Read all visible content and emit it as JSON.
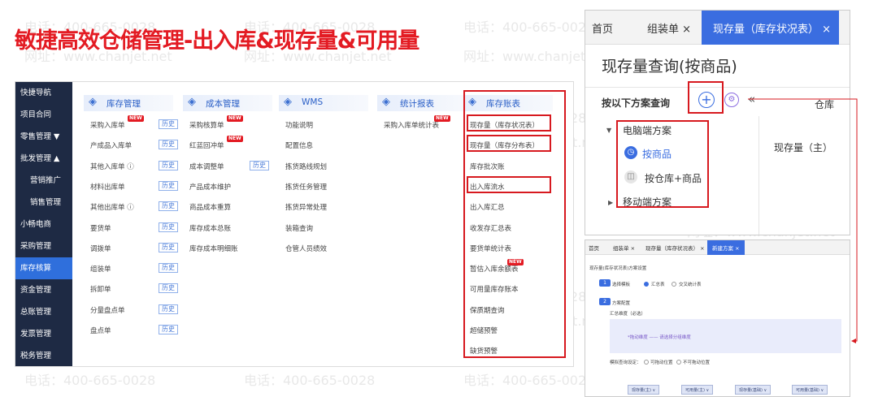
{
  "title": "敏捷高效仓储管理-出入库&现存量&可用量",
  "watermark": {
    "phone": "电话：400-665-0028",
    "site": "网址：www.chanjet.net"
  },
  "nav": {
    "items": [
      {
        "label": "快捷导航",
        "sub": false,
        "active": false
      },
      {
        "label": "项目合同",
        "sub": false,
        "active": false
      },
      {
        "label": "零售管理 ▼",
        "sub": false,
        "active": false
      },
      {
        "label": "批发管理 ▲",
        "sub": false,
        "active": false
      },
      {
        "label": "营销推广",
        "sub": true,
        "active": false
      },
      {
        "label": "销售管理",
        "sub": true,
        "active": false
      },
      {
        "label": "小畅电商",
        "sub": false,
        "active": false
      },
      {
        "label": "采购管理",
        "sub": false,
        "active": false
      },
      {
        "label": "库存核算",
        "sub": false,
        "active": true
      },
      {
        "label": "资金管理",
        "sub": false,
        "active": false
      },
      {
        "label": "总账管理",
        "sub": false,
        "active": false
      },
      {
        "label": "发票管理",
        "sub": false,
        "active": false
      },
      {
        "label": "税务管理",
        "sub": false,
        "active": false
      }
    ]
  },
  "history_label": "历史",
  "new_label": "NEW",
  "columns": [
    {
      "header": "库存管理",
      "items": [
        {
          "label": "采购入库单",
          "hist": true,
          "new": true
        },
        {
          "label": "产成品入库单",
          "hist": true,
          "new": false
        },
        {
          "label": "其他入库单 ⓘ",
          "hist": true,
          "new": false
        },
        {
          "label": "材料出库单",
          "hist": true,
          "new": false
        },
        {
          "label": "其他出库单 ⓘ",
          "hist": true,
          "new": false
        },
        {
          "label": "要货单",
          "hist": true,
          "new": false
        },
        {
          "label": "调拨单",
          "hist": true,
          "new": false
        },
        {
          "label": "组装单",
          "hist": true,
          "new": false
        },
        {
          "label": "拆卸单",
          "hist": true,
          "new": false
        },
        {
          "label": "分量盘点单",
          "hist": true,
          "new": false
        },
        {
          "label": "盘点单",
          "hist": true,
          "new": false
        }
      ]
    },
    {
      "header": "成本管理",
      "items": [
        {
          "label": "采购核算单",
          "hist": false,
          "new": true
        },
        {
          "label": "红蓝回冲单",
          "hist": false,
          "new": true
        },
        {
          "label": "成本调整单",
          "hist": true,
          "new": false
        },
        {
          "label": "产品成本维护",
          "hist": false,
          "new": false
        },
        {
          "label": "商品成本重算",
          "hist": false,
          "new": false
        },
        {
          "label": "库存成本总账",
          "hist": false,
          "new": false
        },
        {
          "label": "库存成本明细账",
          "hist": false,
          "new": false
        }
      ]
    },
    {
      "header": "WMS",
      "items": [
        {
          "label": "功能说明",
          "hist": false,
          "new": false
        },
        {
          "label": "配置信息",
          "hist": false,
          "new": false
        },
        {
          "label": "拣货路线规划",
          "hist": false,
          "new": false
        },
        {
          "label": "拣货任务管理",
          "hist": false,
          "new": false
        },
        {
          "label": "拣货异常处理",
          "hist": false,
          "new": false
        },
        {
          "label": "装箱查询",
          "hist": false,
          "new": false
        },
        {
          "label": "仓管人员绩效",
          "hist": false,
          "new": false
        }
      ]
    },
    {
      "header": "统计报表",
      "items": [
        {
          "label": "采购入库单统计表",
          "hist": false,
          "new": true
        }
      ]
    },
    {
      "header": "库存账表",
      "items": [
        {
          "label": "现存量（库存状况表）",
          "hist": false,
          "new": false,
          "boxed": true
        },
        {
          "label": "现存量（库存分布表）",
          "hist": false,
          "new": false,
          "boxed": true
        },
        {
          "label": "库存批次账",
          "hist": false,
          "new": false
        },
        {
          "label": "出入库流水",
          "hist": false,
          "new": false,
          "boxed": true
        },
        {
          "label": "出入库汇总",
          "hist": false,
          "new": false
        },
        {
          "label": "收发存汇总表",
          "hist": false,
          "new": false
        },
        {
          "label": "要货单统计表",
          "hist": false,
          "new": false
        },
        {
          "label": "暂估入库余额表",
          "hist": false,
          "new": true
        },
        {
          "label": "可用量库存账本",
          "hist": false,
          "new": false
        },
        {
          "label": "保质期查询",
          "hist": false,
          "new": false
        },
        {
          "label": "超储预警",
          "hist": false,
          "new": false
        },
        {
          "label": "缺货预警",
          "hist": false,
          "new": false
        }
      ]
    }
  ],
  "panel": {
    "tabs": [
      {
        "label": "首页",
        "active": false
      },
      {
        "label": "组装单 ×",
        "active": false
      },
      {
        "label": "现存量（库存状况表） ×",
        "active": true
      }
    ],
    "title": "现存量查询(按商品)",
    "query_label": "按以下方案查询",
    "warehouse_label": "仓库",
    "tree": {
      "pc_scheme": "电脑端方案",
      "by_product": "按商品",
      "by_wh_product": "按仓库+商品",
      "mobile_scheme": "移动端方案"
    },
    "qty_main": "现存量（主）",
    "accent": "#3a6de0"
  },
  "panel2": {
    "tabs": [
      {
        "label": "首页",
        "active": false
      },
      {
        "label": "组装单 ×",
        "active": false
      },
      {
        "label": "现存量（库存状况表） ×",
        "active": false
      },
      {
        "label": "新建方案 ×",
        "active": true
      }
    ],
    "heading": "现存量(库存状况表)方案设置",
    "step1": "选择模板",
    "step1_num": "1",
    "opt1": "汇总表",
    "opt2": "交叉统计表",
    "step2": "方案配置",
    "step2_num": "2",
    "summary_dim": "汇总维度（必选）",
    "drop_hint": "*拖动维度 —— 请选择分组维度",
    "query_cond": "模拟查询设定：",
    "opt3": "可拖动位置",
    "opt4": "不可拖动位置",
    "chips": [
      "现存量(主)  ∨",
      "可用量(主)  ∨",
      "现存量(基础)  ∨",
      "可用量(基础)  ∨"
    ]
  },
  "colors": {
    "red": "#d7191f",
    "nav": "#1e2a44",
    "active": "#2f6fdc"
  }
}
